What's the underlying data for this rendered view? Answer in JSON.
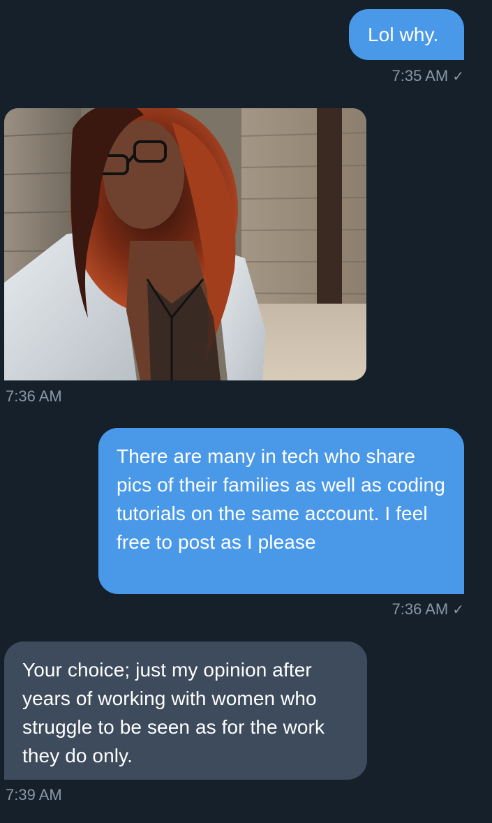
{
  "messages": [
    {
      "type": "text",
      "direction": "sent",
      "text": "Lol why.",
      "time": "7:35 AM",
      "status": "sent-check-icon"
    },
    {
      "type": "image",
      "direction": "received",
      "image": "selfie-photo",
      "time": "7:36 AM"
    },
    {
      "type": "text",
      "direction": "sent",
      "text": "There are many in tech who share pics of their families as well as coding tutorials on the same account. I feel free to post as I please",
      "time": "7:36 AM",
      "status": "sent-check-icon"
    },
    {
      "type": "text",
      "direction": "received",
      "text": "Your choice; just my opinion after years of working with women who struggle to be seen as for the work they do only.",
      "time": "7:39 AM"
    }
  ],
  "colors": {
    "background": "#15202b",
    "sent_bubble": "#4a99e9",
    "received_bubble": "#3d4b5c",
    "timestamp": "#8899a6"
  }
}
